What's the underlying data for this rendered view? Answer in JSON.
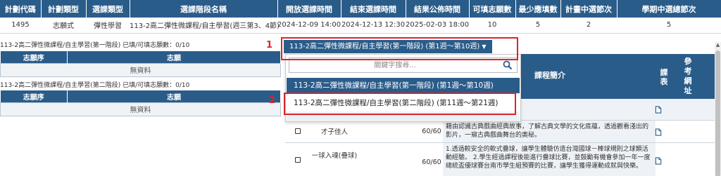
{
  "plan_table": {
    "headers": [
      "計劃代碼",
      "計劃類型",
      "選課類型",
      "選課階段名稱",
      "開放選課時間",
      "結束選課時間",
      "結果公佈時間",
      "可填志願數",
      "最少應填數",
      "計畫中選節次",
      "學期中選總節次"
    ],
    "row": [
      "1495",
      "志願式",
      "彈性學習",
      "113-2高二彈性微課程/自主學習(週三第3、4節)",
      "2024-12-09 14:00",
      "2024-12-13 12:30",
      "2025-02-03 18:00",
      "10",
      "5",
      "2",
      "5"
    ]
  },
  "wish_panels": [
    {
      "caption": "113-2高二彈性微課程/自主學習(第一階段) 已填/可填志願數：0/10",
      "col_order": "志願序",
      "col_wish": "志願",
      "empty_text": "無資料"
    },
    {
      "caption": "113-2高二彈性微課程/自主學習(第二階段) 已填/可填志願數：0/10",
      "col_order": "志願序",
      "col_wish": "志願",
      "empty_text": "無資料"
    }
  ],
  "stage_select": {
    "selected": "113-2高二彈性微課程/自主學習(第一階段) (第1週～第10週)",
    "caret": "▼",
    "search_placeholder": "關鍵字搜尋...",
    "options": [
      "113-2高二彈性微課程/自主學習(第一階段) (第1週～第10週)",
      "113-2高二彈性微課程/自主學習(第二階段) (第11週～第21週)"
    ]
  },
  "annotations": [
    "1",
    "2"
  ],
  "course_table": {
    "col_intro": "課程簡介",
    "col_syllabus": "課表",
    "col_ref": "參考網址",
    "partial_text": "習",
    "rows": [
      {
        "name": "才子佳人",
        "quota": "60/60",
        "desc": "藉由認識古典戲曲經典故事，了解古典文學的文化底蘊，透過觀看淺出的影片，一窺古典戲曲舞台的奧秘。"
      },
      {
        "name": "一球入魂(疊球)",
        "quota": "60/60",
        "desc": "1.透過較安全的軟式疊球，讓學生體驗仿造台灣國球－棒球規則之球類活動經驗。 2.學生經過課程後能進行疊球比賽，並鼓勵有機會參加一年一度總統盃優球賽台南市學生組預賽的比賽，讓學生獲得運動成就與快樂。"
      }
    ]
  },
  "colors": {
    "header_blue": "#2a5c8a",
    "annotation_red": "#d9252c"
  }
}
